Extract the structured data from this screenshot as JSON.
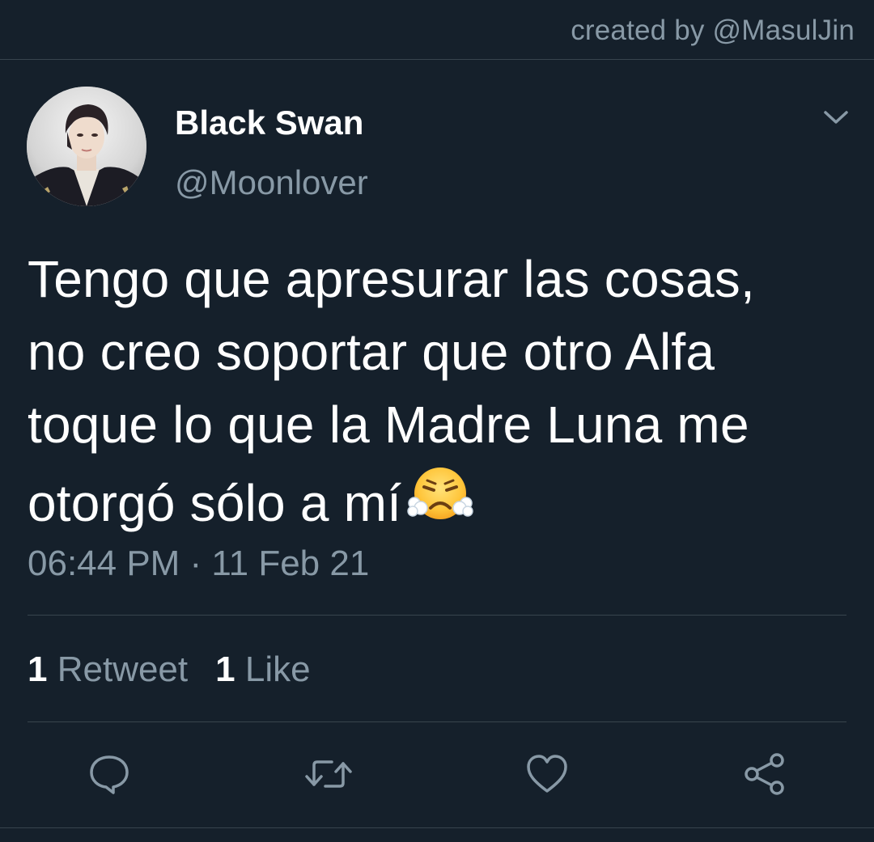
{
  "header": {
    "credit": "created by @MasulJin"
  },
  "tweet": {
    "author": {
      "display_name": "Black Swan",
      "handle": "@Moonlover",
      "avatar_icon": "avatar-photo"
    },
    "text_lines": [
      "Tengo que apresurar las cosas,",
      "no creo soportar que otro Alfa",
      "toque lo que la Madre Luna me",
      "otorgó sólo a mí"
    ],
    "emoji": "face-with-steam-from-nose",
    "timestamp": "06:44 PM · 11 Feb 21",
    "stats": {
      "retweets_count": "1",
      "retweets_label": "Retweet",
      "likes_count": "1",
      "likes_label": "Like"
    },
    "actions": {
      "reply_icon": "reply-icon",
      "retweet_icon": "retweet-icon",
      "like_icon": "heart-icon",
      "share_icon": "share-icon"
    }
  },
  "colors": {
    "background": "#15202b",
    "secondary_text": "#8899a6",
    "divider": "#38444d",
    "primary_text": "#ffffff"
  }
}
